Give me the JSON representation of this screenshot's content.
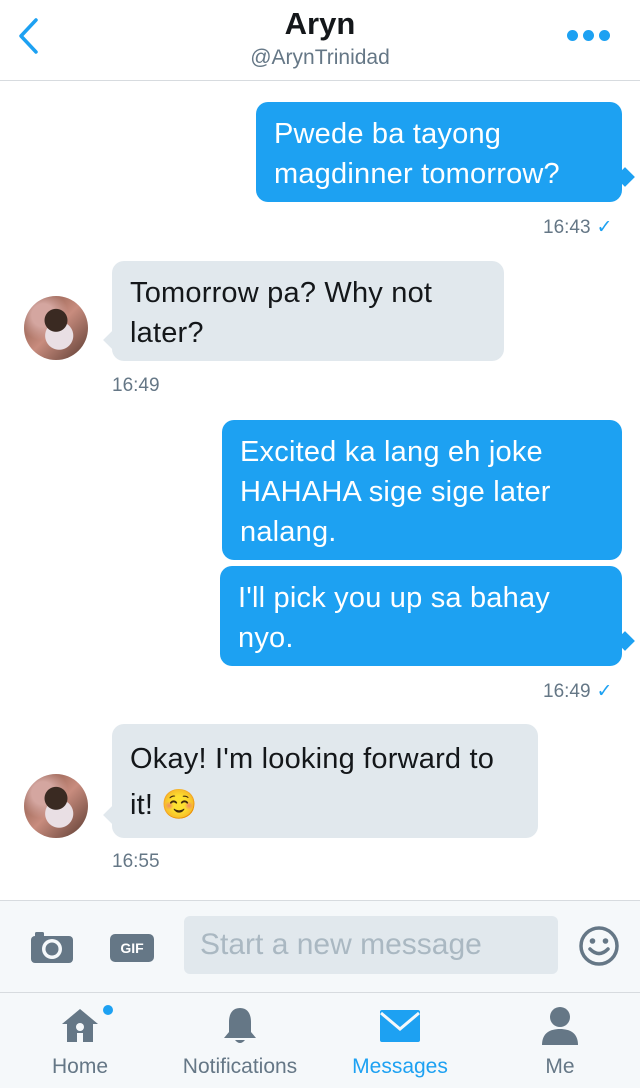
{
  "header": {
    "name": "Aryn",
    "handle": "@ArynTrinidad"
  },
  "messages": [
    {
      "side": "out",
      "lines": "Pwede ba tayong magdinner tomorrow?",
      "time": "16:43",
      "read": "✓"
    },
    {
      "side": "in",
      "lines": "Tomorrow pa? Why not later?",
      "time": "16:49"
    },
    {
      "side": "out",
      "lines": "Excited ka lang eh joke HAHAHA sige sige later nalang."
    },
    {
      "side": "out",
      "lines": "I'll pick you up sa bahay nyo.",
      "time": "16:49",
      "read": "✓"
    },
    {
      "side": "in",
      "lines": "Okay! I'm looking forward to it! ☺️",
      "time": "16:55"
    }
  ],
  "composer": {
    "placeholder": "Start a new message",
    "gif_label": "GIF"
  },
  "tabs": [
    {
      "label": "Home",
      "has_dot": true
    },
    {
      "label": "Notifications"
    },
    {
      "label": "Messages",
      "active": true
    },
    {
      "label": "Me"
    }
  ],
  "colors": {
    "accent": "#1da1f2",
    "incoming_bubble": "#e1e8ed",
    "muted": "#657786"
  }
}
